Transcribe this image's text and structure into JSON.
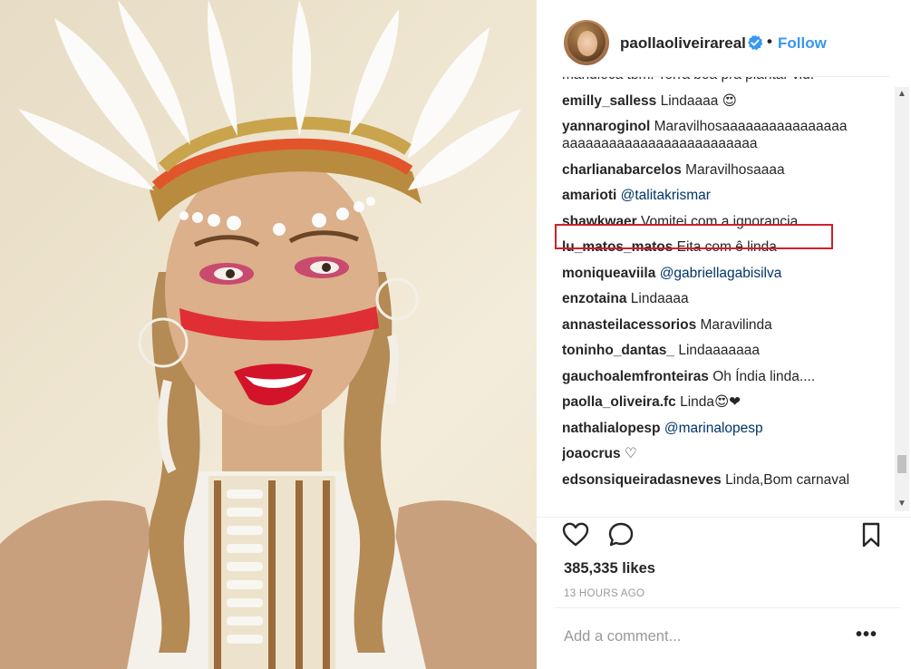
{
  "post": {
    "username": "paollaoliveirareal",
    "follow_label": "Follow",
    "separator": "•",
    "verified_icon": "verified-badge-icon",
    "likes": "385,335 likes",
    "time": "13 HOURS AGO",
    "add_comment_placeholder": "Add a comment...",
    "more_label": "•••"
  },
  "comments": [
    {
      "user": "",
      "text": "mandioca tbm. Terra boa pra plantar vid."
    },
    {
      "user": "emilly_salless",
      "text": "Lindaaaa 😍"
    },
    {
      "user": "yannaroginol",
      "text": "Maravilhosaaaaaaaaaaaaaaaa aaaaaaaaaaaaaaaaaaaaaaaaa"
    },
    {
      "user": "charlianabarcelos",
      "text": "Maravilhosaaaa"
    },
    {
      "user": "amarioti",
      "text": "@talitakrismar",
      "mention": true
    },
    {
      "user": "shawkwaer",
      "text": "Vomitei com a ignorancia"
    },
    {
      "user": "lu_matos_matos",
      "text": "Eita com ê linda"
    },
    {
      "user": "moniqueaviila",
      "text": "@gabriellagabisilva",
      "mention": true
    },
    {
      "user": "enzotaina",
      "text": "Lindaaaa"
    },
    {
      "user": "annasteilacessorios",
      "text": "Maravilinda"
    },
    {
      "user": "toninho_dantas_",
      "text": "Lindaaaaaaa"
    },
    {
      "user": "gauchoalemfronteiras",
      "text": "Oh Índia linda...."
    },
    {
      "user": "paolla_oliveira.fc",
      "text": "Linda😍❤"
    },
    {
      "user": "nathalialopesp",
      "text": "@marinalopesp",
      "mention": true
    },
    {
      "user": "joaocrus",
      "text": "♡"
    },
    {
      "user": "edsonsiqueiradasneves",
      "text": "Linda,Bom carnaval"
    }
  ],
  "colors": {
    "link_blue": "#3897f0",
    "mention": "#003569",
    "highlight_red": "#d0202a",
    "meta_gray": "#999999"
  }
}
